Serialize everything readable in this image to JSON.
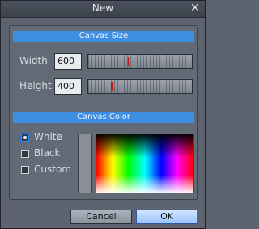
{
  "window": {
    "title": "New",
    "close_label": "✕"
  },
  "canvas_size": {
    "header": "Canvas Size",
    "width": {
      "label": "Width",
      "value": "600",
      "slider_fraction": 0.38
    },
    "height": {
      "label": "Height",
      "value": "400",
      "slider_fraction": 0.22
    }
  },
  "canvas_color": {
    "header": "Canvas Color",
    "options": [
      {
        "label": "White",
        "selected": true
      },
      {
        "label": "Black",
        "selected": false
      },
      {
        "label": "Custom",
        "selected": false
      }
    ],
    "swatch_color": "#8a8f93"
  },
  "buttons": {
    "cancel": "Cancel",
    "ok": "OK"
  },
  "colors": {
    "accent": "#3f8ee4",
    "slider_marker": "#c01818"
  }
}
